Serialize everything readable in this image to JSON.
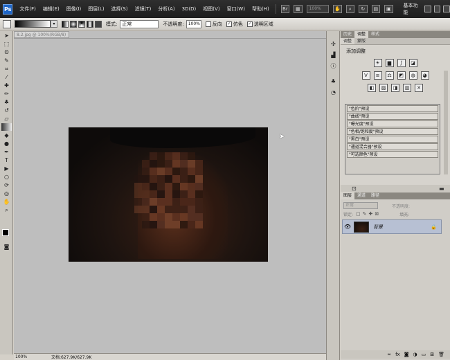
{
  "menubar": {
    "logo": "Ps",
    "menus": [
      "文件(F)",
      "编辑(E)",
      "图像(I)",
      "图层(L)",
      "选择(S)",
      "滤镜(T)",
      "分析(A)",
      "3D(D)",
      "视图(V)",
      "窗口(W)",
      "帮助(H)"
    ],
    "zoom_value": "100%",
    "workspace": "基本功能"
  },
  "options": {
    "mode_label": "模式:",
    "mode_value": "正常",
    "opacity_label": "不透明度:",
    "opacity_value": "100%",
    "reverse_label": "反向",
    "dither_label": "仿色",
    "transparency_label": "透明区域"
  },
  "document": {
    "tab_title": "8.2.jpg @ 100%(RGB/8)",
    "zoom_status": "100%",
    "doc_info": "文档:627.9K/627.9K"
  },
  "adjustments": {
    "tabs": [
      "历史",
      "调整",
      "样式"
    ],
    "active_tab": "调整",
    "sub_tabs": [
      "调整",
      "蒙版"
    ],
    "title": "添加调整",
    "presets": [
      "\"色阶\"预设",
      "\"曲线\"预设",
      "\"曝光度\"预设",
      "\"色相/饱和度\"预设",
      "\"黑白\"预设",
      "\"通道混合器\"预设",
      "\"可选颜色\"预设"
    ]
  },
  "layers": {
    "tabs": [
      "图层",
      "通道",
      "路径"
    ],
    "blend_mode": "正常",
    "opacity_label": "不透明度:",
    "fill_label": "填充:",
    "lock_label": "锁定:",
    "layer_name": "背景"
  },
  "colors": {
    "menubar_bg": "#252525",
    "ps_logo": "#1f66c7",
    "selected_layer": "#b7c0d3"
  }
}
